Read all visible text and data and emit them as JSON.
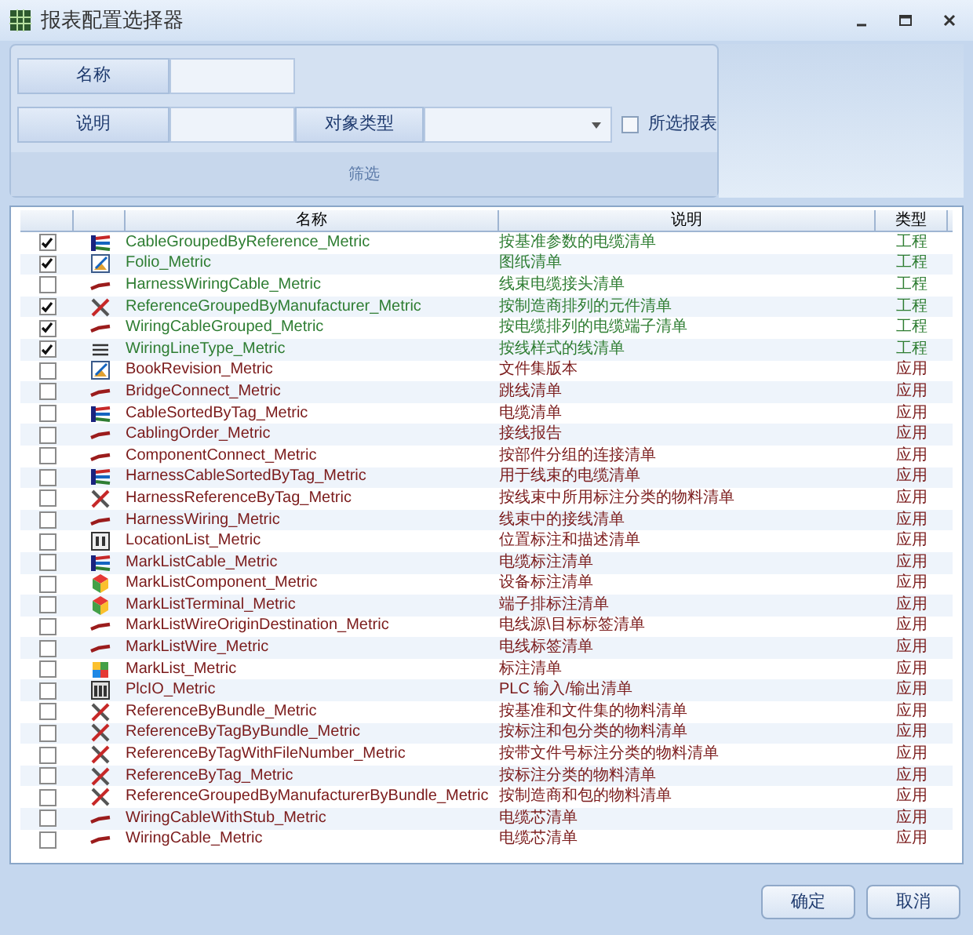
{
  "window": {
    "title": "报表配置选择器"
  },
  "filter": {
    "name_label": "名称",
    "desc_label": "说明",
    "type_label": "对象类型",
    "selected_only": {
      "label": "所选报表",
      "checked": false
    },
    "group_label": "筛选"
  },
  "table": {
    "columns": [
      "名称",
      "说明",
      "类型"
    ],
    "rows": [
      {
        "checked": true,
        "kind": "cable",
        "color": "#2e7d32",
        "name": "CableGroupedByReference_Metric",
        "desc": "按基准参数的电缆清单",
        "type": "工程"
      },
      {
        "checked": true,
        "kind": "document",
        "color": "#2e7d32",
        "name": "Folio_Metric",
        "desc": "图纸清单",
        "type": "工程"
      },
      {
        "checked": false,
        "kind": "wire",
        "color": "#2e7d32",
        "name": "HarnessWiringCable_Metric",
        "desc": "线束电缆接头清单",
        "type": "工程"
      },
      {
        "checked": true,
        "kind": "tools",
        "color": "#2e7d32",
        "name": "ReferenceGroupedByManufacturer_Metric",
        "desc": "按制造商排列的元件清单",
        "type": "工程"
      },
      {
        "checked": true,
        "kind": "wire",
        "color": "#2e7d32",
        "name": "WiringCableGrouped_Metric",
        "desc": "按电缆排列的电缆端子清单",
        "type": "工程"
      },
      {
        "checked": true,
        "kind": "lines",
        "color": "#2e7d32",
        "name": "WiringLineType_Metric",
        "desc": "按线样式的线清单",
        "type": "工程"
      },
      {
        "checked": false,
        "kind": "document",
        "color": "#7a1a1a",
        "name": "BookRevision_Metric",
        "desc": "文件集版本",
        "type": "应用"
      },
      {
        "checked": false,
        "kind": "wire",
        "color": "#7a1a1a",
        "name": "BridgeConnect_Metric",
        "desc": "跳线清单",
        "type": "应用"
      },
      {
        "checked": false,
        "kind": "cable",
        "color": "#7a1a1a",
        "name": "CableSortedByTag_Metric",
        "desc": "电缆清单",
        "type": "应用"
      },
      {
        "checked": false,
        "kind": "wire",
        "color": "#7a1a1a",
        "name": "CablingOrder_Metric",
        "desc": "接线报告",
        "type": "应用"
      },
      {
        "checked": false,
        "kind": "wire",
        "color": "#7a1a1a",
        "name": "ComponentConnect_Metric",
        "desc": "按部件分组的连接清单",
        "type": "应用"
      },
      {
        "checked": false,
        "kind": "cable",
        "color": "#7a1a1a",
        "name": "HarnessCableSortedByTag_Metric",
        "desc": "用于线束的电缆清单",
        "type": "应用"
      },
      {
        "checked": false,
        "kind": "tools",
        "color": "#7a1a1a",
        "name": "HarnessReferenceByTag_Metric",
        "desc": "按线束中所用标注分类的物料清单",
        "type": "应用"
      },
      {
        "checked": false,
        "kind": "wire",
        "color": "#7a1a1a",
        "name": "HarnessWiring_Metric",
        "desc": "线束中的接线清单",
        "type": "应用"
      },
      {
        "checked": false,
        "kind": "location",
        "color": "#7a1a1a",
        "name": "LocationList_Metric",
        "desc": "位置标注和描述清单",
        "type": "应用"
      },
      {
        "checked": false,
        "kind": "cable",
        "color": "#7a1a1a",
        "name": "MarkListCable_Metric",
        "desc": "电缆标注清单",
        "type": "应用"
      },
      {
        "checked": false,
        "kind": "cubes",
        "color": "#7a1a1a",
        "name": "MarkListComponent_Metric",
        "desc": "设备标注清单",
        "type": "应用"
      },
      {
        "checked": false,
        "kind": "cubes",
        "color": "#7a1a1a",
        "name": "MarkListTerminal_Metric",
        "desc": "端子排标注清单",
        "type": "应用"
      },
      {
        "checked": false,
        "kind": "wire",
        "color": "#7a1a1a",
        "name": "MarkListWireOriginDestination_Metric",
        "desc": "电线源\\目标标签清单",
        "type": "应用"
      },
      {
        "checked": false,
        "kind": "wire",
        "color": "#7a1a1a",
        "name": "MarkListWire_Metric",
        "desc": "电线标签清单",
        "type": "应用"
      },
      {
        "checked": false,
        "kind": "tiles",
        "color": "#7a1a1a",
        "name": "MarkList_Metric",
        "desc": "标注清单",
        "type": "应用"
      },
      {
        "checked": false,
        "kind": "plc",
        "color": "#7a1a1a",
        "name": "PlcIO_Metric",
        "desc": "PLC 输入/输出清单",
        "type": "应用"
      },
      {
        "checked": false,
        "kind": "tools",
        "color": "#7a1a1a",
        "name": "ReferenceByBundle_Metric",
        "desc": "按基准和文件集的物料清单",
        "type": "应用"
      },
      {
        "checked": false,
        "kind": "tools",
        "color": "#7a1a1a",
        "name": "ReferenceByTagByBundle_Metric",
        "desc": "按标注和包分类的物料清单",
        "type": "应用"
      },
      {
        "checked": false,
        "kind": "tools",
        "color": "#7a1a1a",
        "name": "ReferenceByTagWithFileNumber_Metric",
        "desc": "按带文件号标注分类的物料清单",
        "type": "应用"
      },
      {
        "checked": false,
        "kind": "tools",
        "color": "#7a1a1a",
        "name": "ReferenceByTag_Metric",
        "desc": "按标注分类的物料清单",
        "type": "应用"
      },
      {
        "checked": false,
        "kind": "tools",
        "color": "#7a1a1a",
        "name": "ReferenceGroupedByManufacturerByBundle_Metric",
        "desc": "按制造商和包的物料清单",
        "type": "应用"
      },
      {
        "checked": false,
        "kind": "wire",
        "color": "#7a1a1a",
        "name": "WiringCableWithStub_Metric",
        "desc": "电缆芯清单",
        "type": "应用"
      },
      {
        "checked": false,
        "kind": "wire",
        "color": "#7a1a1a",
        "name": "WiringCable_Metric",
        "desc": "电缆芯清单",
        "type": "应用"
      }
    ]
  },
  "buttons": [
    "确定",
    "取消"
  ]
}
